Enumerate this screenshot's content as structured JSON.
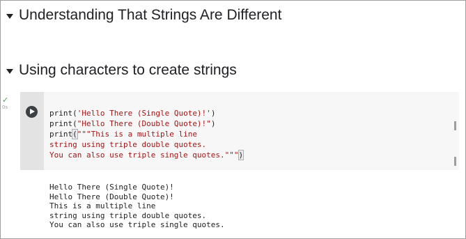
{
  "sections": [
    {
      "title": "Understanding That Strings Are Different"
    },
    {
      "title": "Using characters to create strings"
    }
  ],
  "cell": {
    "status_time": "0s",
    "code_lines": [
      {
        "fn": "print",
        "arg": "'Hello There (Single Quote)!'"
      },
      {
        "fn": "print",
        "arg": "\"Hello There (Double Quote)!\""
      },
      {
        "fn": "print",
        "arg": "\"\"\"This is a multiple line"
      },
      {
        "text": "string using triple double quotes."
      },
      {
        "text": "You can also use triple single quotes.\"\"\""
      }
    ],
    "toolbar_icons": [
      "arrow-up-icon",
      "arrow-down-icon",
      "link-icon",
      "comment-icon",
      "settings-icon",
      "mirror-cell-icon",
      "delete-icon",
      "more-icon"
    ]
  },
  "output_lines": [
    "Hello There (Single Quote)!",
    "Hello There (Double Quote)!",
    "This is a multiple line",
    "string using triple double quotes.",
    "You can also use triple single quotes."
  ],
  "colors": {
    "string": "#a31515",
    "cell_bg": "#f7f7f7",
    "gutter_bg": "#e3e3e3",
    "check": "#34a853"
  }
}
